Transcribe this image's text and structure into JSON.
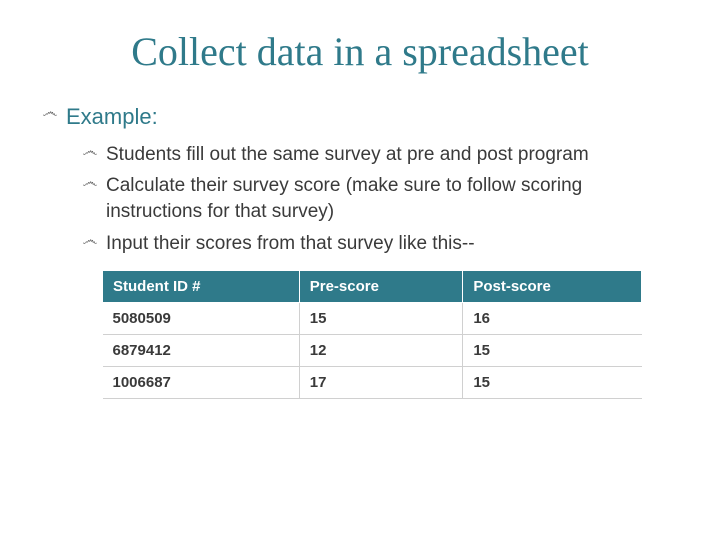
{
  "title": "Collect data in a spreadsheet",
  "bullet_glyph": "෴",
  "lvl1": {
    "example": "Example:"
  },
  "lvl2": {
    "b1": "Students fill out the same survey at pre and post program",
    "b2": "Calculate their survey score (make sure to follow scoring instructions for that survey)",
    "b3": "Input their scores from that survey like this--"
  },
  "table": {
    "headers": {
      "c1": "Student ID #",
      "c2": "Pre-score",
      "c3": "Post-score"
    },
    "rows": [
      {
        "c1": "5080509",
        "c2": "15",
        "c3": "16"
      },
      {
        "c1": "6879412",
        "c2": "12",
        "c3": "15"
      },
      {
        "c1": "1006687",
        "c2": "17",
        "c3": "15"
      }
    ]
  }
}
